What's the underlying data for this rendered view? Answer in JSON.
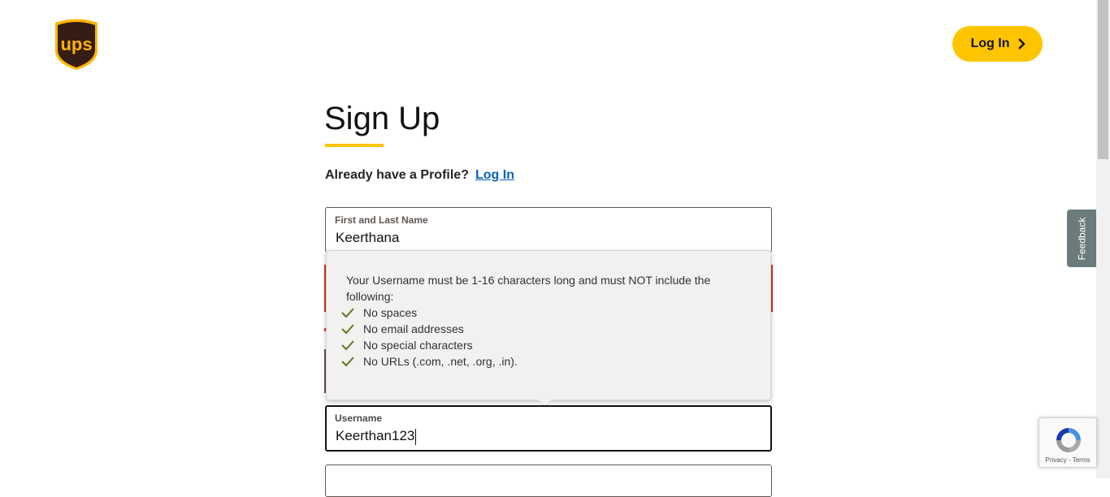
{
  "brand": {
    "logo_text": "ups",
    "accent_color": "#ffc400",
    "logo_brown": "#351c15"
  },
  "header": {
    "login_button": "Log In"
  },
  "page": {
    "title": "Sign Up",
    "already_text": "Already have a Profile?",
    "already_link": "Log In"
  },
  "form": {
    "name_field": {
      "label": "First and Last Name",
      "value": "Keerthana"
    },
    "username_field": {
      "label": "Username",
      "value": "Keerthan123"
    }
  },
  "tooltip": {
    "intro": "Your Username must be 1-16 characters long and must NOT include the following:",
    "rules": [
      "No spaces",
      "No email addresses",
      "No special characters",
      "No URLs (.com, .net, .org, .in)."
    ]
  },
  "feedback_tab": "Feedback",
  "recaptcha": {
    "links": "Privacy - Terms"
  },
  "colors": {
    "error": "#d4351c",
    "link": "#0662bb",
    "check": "#5a7a1e"
  }
}
